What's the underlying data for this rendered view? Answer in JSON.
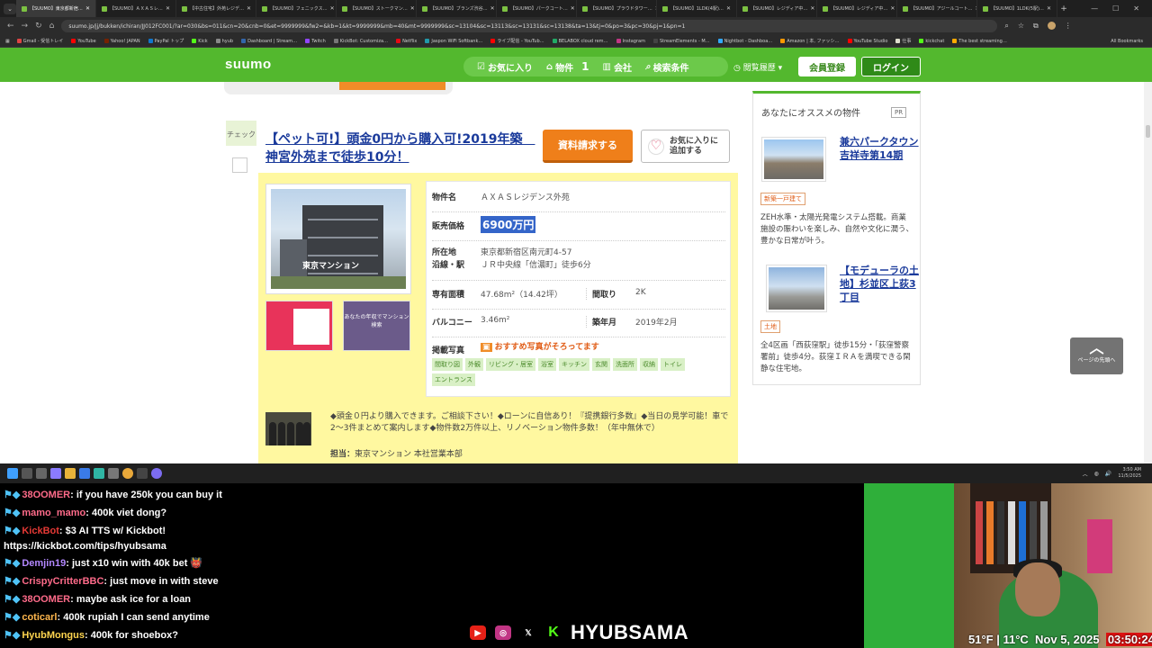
{
  "browser": {
    "tabs": [
      {
        "label": "【SUUMO】東京都新宿…",
        "active": true
      },
      {
        "label": "【SUUMO】ＡＸＡＳレ…"
      },
      {
        "label": "【中古住宅】外苑レジデ…"
      },
      {
        "label": "【SUUMO】フェニックス…"
      },
      {
        "label": "【SUUMO】ストークマン…"
      },
      {
        "label": "【SUUMO】ブランズ渋谷…"
      },
      {
        "label": "【SUUMO】パークコート…"
      },
      {
        "label": "【SUUMO】プラウドタワー…"
      },
      {
        "label": "【SUUMO】1LDK(4駅)…"
      },
      {
        "label": "【SUUMO】レジディア中…"
      },
      {
        "label": "【SUUMO】レジディア中…"
      },
      {
        "label": "【SUUMO】アジールコート…"
      },
      {
        "label": "【SUUMO】1LDK(5駅)…"
      }
    ],
    "url": "suumo.jp/jj/bukken/ichiran/JJ012FC001/?ar=030&bs=011&cn=20&cnb=0&et=9999999&fw2=&kb=1&kt=9999999&mb=40&mt=9999999&sc=13104&sc=13113&sc=13131&sc=13138&ta=13&tj=0&po=3&pc=30&pj=1&pn=1",
    "bookmarks": [
      "Gmail - 受信トレイ",
      "YouTube",
      "Yahoo! JAPAN",
      "PayPal トップ",
      "Kick",
      "hyub",
      "Dashboard | Stream…",
      "Twitch",
      "KickBot: Customiza…",
      "Netflix",
      "Jaspon WiFi Softbank…",
      "ライブ配信 - YouTub…",
      "BELABOX cloud rem…",
      "Instagram",
      "StreamElements - M…",
      "Nightbot - Dashboa…",
      "Amazon | 本, ファッシ…",
      "YouTube Studio",
      "仕事",
      "kickchat",
      "The best streaming…"
    ],
    "all_bookmarks": "All Bookmarks"
  },
  "nav": {
    "logo": "suumo",
    "favorites": "お気に入り",
    "property_label": "物件",
    "property_count": "1",
    "company": "会社",
    "search_cond": "検索条件",
    "history": "閲覧履歴",
    "register": "会員登録",
    "login": "ログイン"
  },
  "listing": {
    "check_label": "チェック",
    "title": "【ペット可!】頭金0円から購入可!2019年築　神宮外苑まで徒歩10分！",
    "request_btn": "資料請求する",
    "fav_btn_line1": "お気に入りに",
    "fav_btn_line2": "追加する",
    "building_sign": "東京マンション",
    "thumb2_text": "あなたの年収でマンション検索",
    "name_label": "物件名",
    "name": "ＡＸＡＳレジデンス外苑",
    "price_label": "販売価格",
    "price": "6900万円",
    "address_label": "所在地",
    "address": "東京都新宿区南元町4-57",
    "line_label": "沿線・駅",
    "line": "ＪＲ中央線「信濃町」徒歩6分",
    "area_label": "専有面積",
    "area": "47.68m²（14.42坪）",
    "layout_label": "間取り",
    "layout": "2K",
    "balcony_label": "バルコニー",
    "balcony": "3.46m²",
    "built_label": "築年月",
    "built": "2019年2月",
    "photos_label": "掲載写真",
    "photos_recommend": "おすすめ写真がそろってます",
    "photo_tags": [
      "間取り図",
      "外観",
      "リビング・居室",
      "浴室",
      "キッチン",
      "玄関",
      "洗面所",
      "収納",
      "トイレ",
      "エントランス"
    ],
    "comment": "◆頭金０円より購入できます。ご相談下さい！◆ローンに自信あり！『提携銀行多数』◆当日の見学可能！車で2〜3件まとめて案内します◆物件数2万件以上、リノベーション物件多数！（年中無休で）",
    "tanto_label": "担当：",
    "tanto": "東京マンション 本社営業本部"
  },
  "sidebar": {
    "header": "あなたにオススメの物件",
    "pr": "PR",
    "items": [
      {
        "title": "兼六パークタウン吉祥寺第14期",
        "badge": "新築一戸建て",
        "desc": "ZEH水準・太陽光発電システム搭載。商業施設の賑わいを楽しみ、自然や文化に潤う、豊かな日常が叶う。"
      },
      {
        "title": "【モデューラの土地】杉並区上荻3丁目",
        "badge": "土地",
        "desc": "全4区画「西荻窪駅」徒歩15分・「荻窪警察署前」徒歩4分。荻窪ＩＲＡを満喫できる閑静な住宅地。"
      }
    ]
  },
  "page_top": "ページの先頭へ",
  "taskbar": {
    "time": "3:50 AM",
    "date": "11/5/2025"
  },
  "chat": [
    {
      "user": "38OOMER",
      "color": "#ff6b8a",
      "text": "if you have 250k you can buy it"
    },
    {
      "user": "mamo_mamo",
      "color": "#ff6b8a",
      "text": "400k viet dong?"
    },
    {
      "user": "KickBot",
      "color": "#e53935",
      "text": "$3 AI TTS w/ Kickbot!"
    },
    {
      "user": "",
      "color": "#fff",
      "text": "https://kickbot.com/tips/hyubsama"
    },
    {
      "user": "Demjin19",
      "color": "#b388ff",
      "text": "just x10 win with 40k bet 👹"
    },
    {
      "user": "CrispyCritterBBC",
      "color": "#ff6b8a",
      "text": "just move in with steve"
    },
    {
      "user": "38OOMER",
      "color": "#ff6b8a",
      "text": "maybe ask ice for a loan"
    },
    {
      "user": "coticarl",
      "color": "#ffb74d",
      "text": "400k rupiah I can send anytime"
    },
    {
      "user": "HyubMongus",
      "color": "#ffd54f",
      "text": "400k for shoebox?"
    }
  ],
  "stream": {
    "brand": "HYUBSAMA",
    "weather": "51°F | 11°C",
    "date": "Nov 5, 2025",
    "time": "03:50:24"
  }
}
